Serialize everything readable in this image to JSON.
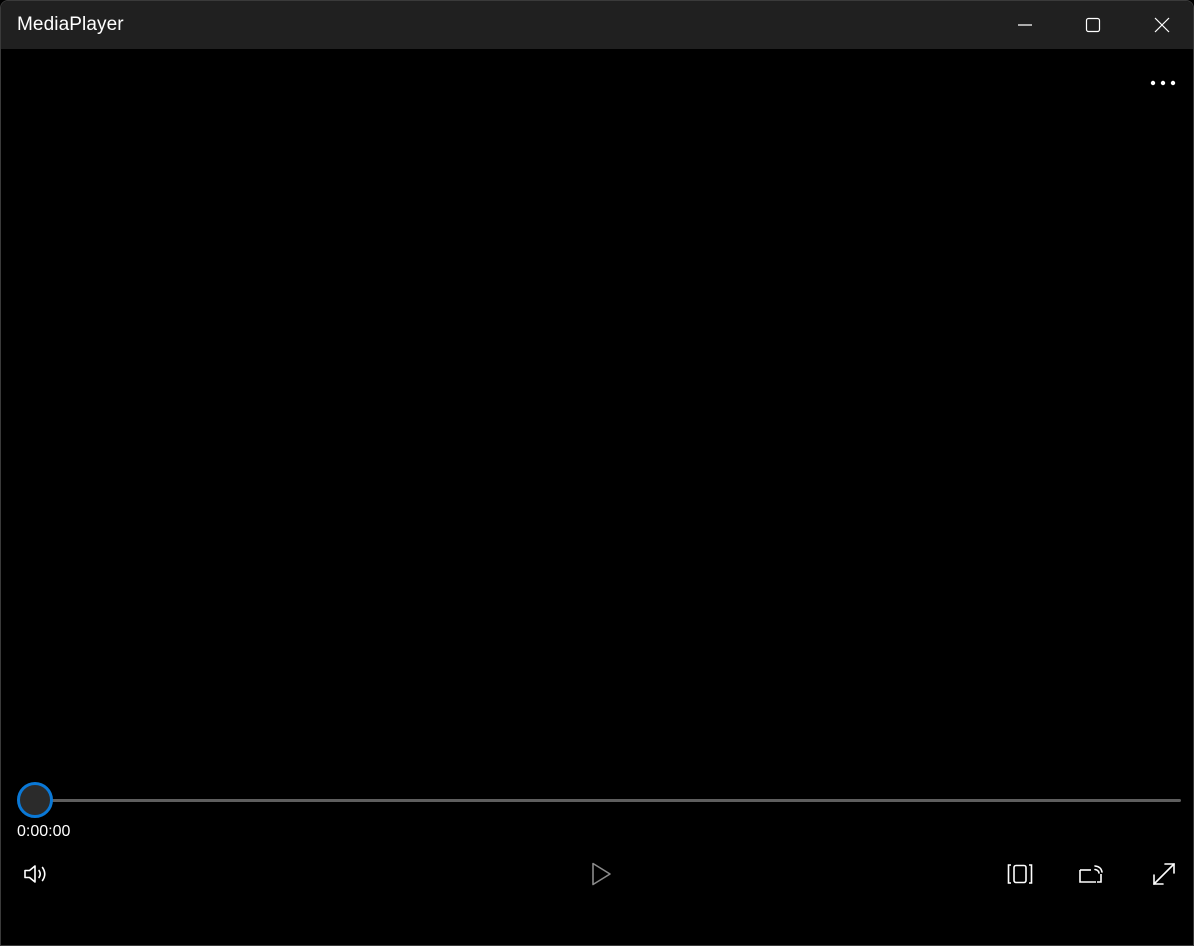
{
  "window": {
    "title": "MediaPlayer",
    "controls": {
      "minimize_icon": "minimize-icon",
      "maximize_icon": "maximize-icon",
      "close_icon": "close-icon"
    }
  },
  "player": {
    "more_icon": "more-icon",
    "current_time": "0:00:00",
    "progress": 0,
    "controls": {
      "volume_icon": "volume-icon",
      "play_icon": "play-icon",
      "aspect_ratio_icon": "aspect-ratio-icon",
      "cast_icon": "cast-icon",
      "fullscreen_icon": "fullscreen-icon"
    }
  },
  "colors": {
    "titlebar_bg": "#202020",
    "video_bg": "#000000",
    "accent": "#0A78D6",
    "track": "#5E5E5E",
    "text": "#FFFFFF"
  }
}
